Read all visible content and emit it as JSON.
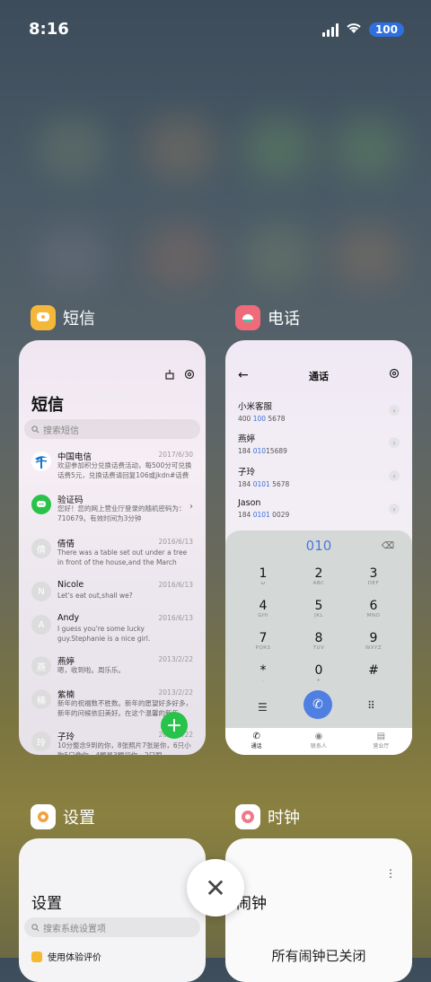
{
  "status_bar": {
    "time": "8:16",
    "battery": "100"
  },
  "apps": {
    "messages": {
      "label": "短信",
      "title": "短信",
      "search_placeholder": "搜索短信",
      "items": [
        {
          "avatar": "",
          "name": "中国电信",
          "date": "2017/6/30",
          "body": "欢迎参加积分兑换话费活动，每500分可兑换话费5元，兑换话费请回复106或jkdn#话费"
        },
        {
          "avatar": "",
          "name": "验证码",
          "date": "",
          "body": "您好！您的网上营业厅登录的随机密码为：710679。有效时间为3分钟"
        },
        {
          "avatar": "倩",
          "name": "倩倩",
          "date": "2016/6/13",
          "body": "There was a table set out under a tree in front of the house,and the March Hare an..."
        },
        {
          "avatar": "N",
          "name": "Nicole",
          "date": "2016/6/13",
          "body": "Let's eat out,shall we?"
        },
        {
          "avatar": "A",
          "name": "Andy",
          "date": "2016/6/13",
          "body": "I guess you're some lucky guy.Stephanie is a nice girl."
        },
        {
          "avatar": "燕",
          "name": "燕婷",
          "date": "2013/2/22",
          "body": "嗯，收到啦。周乐乐。"
        },
        {
          "avatar": "楠",
          "name": "紫楠",
          "date": "2013/2/22",
          "body": "新年的祝福数不胜数。新年的愿望好多好多，新年的问候依旧美好。在这个温馨的新年"
        },
        {
          "avatar": "玲",
          "name": "子玲",
          "date": "2013/2/22",
          "body": "10分整念9到的你，8张照片7张是你，6只小狗5只像你，4颗星3颗初你，2只眼"
        }
      ]
    },
    "phone": {
      "label": "电话",
      "title": "通话",
      "contacts": [
        {
          "name": "小米客服",
          "pre": "400 ",
          "hl": "100",
          "post": " 5678"
        },
        {
          "name": "燕婷",
          "pre": "184 ",
          "hl": "010",
          "post": "15689"
        },
        {
          "name": "子玲",
          "pre": "184 ",
          "hl": "0101",
          "post": " 5678"
        },
        {
          "name": "Jason",
          "pre": "184 ",
          "hl": "0101",
          "post": " 0029"
        }
      ],
      "dialed": "010",
      "keys": [
        {
          "k": "1",
          "s": "ω"
        },
        {
          "k": "2",
          "s": "ABC"
        },
        {
          "k": "3",
          "s": "DEF"
        },
        {
          "k": "4",
          "s": "GHI"
        },
        {
          "k": "5",
          "s": "JKL"
        },
        {
          "k": "6",
          "s": "MNO"
        },
        {
          "k": "7",
          "s": "PQRS"
        },
        {
          "k": "8",
          "s": "TUV"
        },
        {
          "k": "9",
          "s": "WXYZ"
        },
        {
          "k": "*",
          "s": ","
        },
        {
          "k": "0",
          "s": "+"
        },
        {
          "k": "#",
          "s": ""
        }
      ],
      "tabs": [
        "通话",
        "联系人",
        "营业厅"
      ]
    },
    "settings": {
      "label": "设置",
      "title": "设置",
      "search_placeholder": "搜索系统设置项",
      "first_row": "使用体验评价"
    },
    "clock": {
      "label": "时钟",
      "title": "闹钟",
      "status": "所有闹钟已关闭"
    }
  },
  "colors": {
    "accent": "#4f77d9",
    "fab": "#29c24a",
    "battery": "#2f6fe0"
  }
}
